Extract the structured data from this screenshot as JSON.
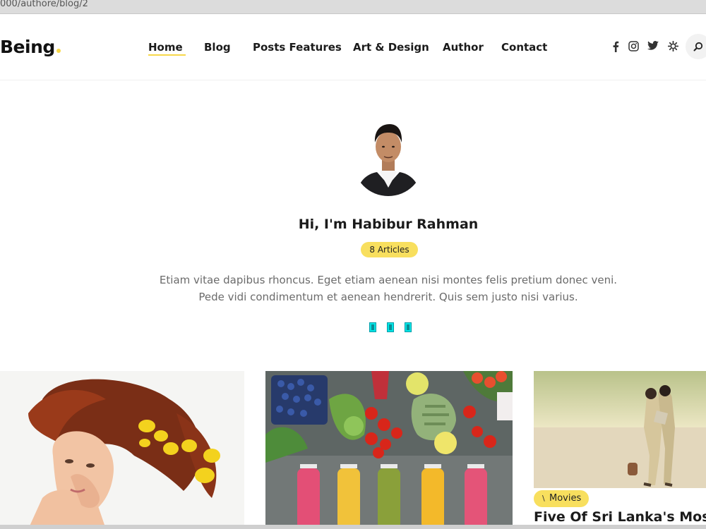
{
  "browser": {
    "url": "000/authore/blog/2"
  },
  "header": {
    "logo": "Being",
    "nav": [
      "Home",
      "Blog",
      "Posts Features",
      "Art & Design",
      "Author",
      "Contact"
    ],
    "active_nav": "Home",
    "social_icons": [
      "facebook-icon",
      "instagram-icon",
      "twitter-icon",
      "settings-icon",
      "search-icon"
    ]
  },
  "author": {
    "name": "Hi, I'm Habibur Rahman",
    "articles_badge": "8 Articles",
    "bio_line1": "Etiam vitae dapibus rhoncus. Eget etiam aenean nisi montes felis pretium donec veni.",
    "bio_line2": "Pede vidi condimentum et aenean hendrerit. Quis sem justo nisi varius."
  },
  "posts": [
    {
      "image": "woman-with-flowers-in-hair"
    },
    {
      "image": "vegetables-and-juice-bottles"
    },
    {
      "image": "couple-on-beach",
      "category": "Movies",
      "title": "Five Of Sri Lanka's Most F"
    }
  ],
  "colors": {
    "accent": "#f8df5e",
    "text": "#1b1b1b",
    "muted": "#6b6b6b"
  }
}
